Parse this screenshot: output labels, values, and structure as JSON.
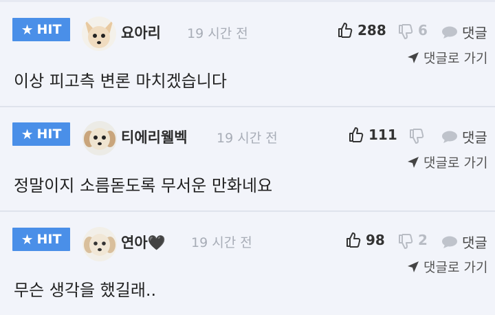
{
  "badge_label": "HIT",
  "comments": [
    {
      "nickname": "요아리",
      "time": "19 시간 전",
      "likes": "288",
      "dislikes": "6",
      "reply_label": "댓글",
      "goto_label": "댓글로 가기",
      "text": "이상 피고측 변론 마치겠습니다"
    },
    {
      "nickname": "티에리웰벡",
      "time": "19 시간 전",
      "likes": "111",
      "dislikes": "",
      "reply_label": "댓글",
      "goto_label": "댓글로 가기",
      "text": "정말이지 소름돋도록 무서운 만화네요"
    },
    {
      "nickname": "연아🖤",
      "time": "19 시간 전",
      "likes": "98",
      "dislikes": "2",
      "reply_label": "댓글",
      "goto_label": "댓글로 가기",
      "text": "무슨 생각을 했길래.."
    }
  ],
  "colors": {
    "badge": "#4a8fe8",
    "background": "#f2f4fa",
    "muted": "#a7acb6"
  }
}
